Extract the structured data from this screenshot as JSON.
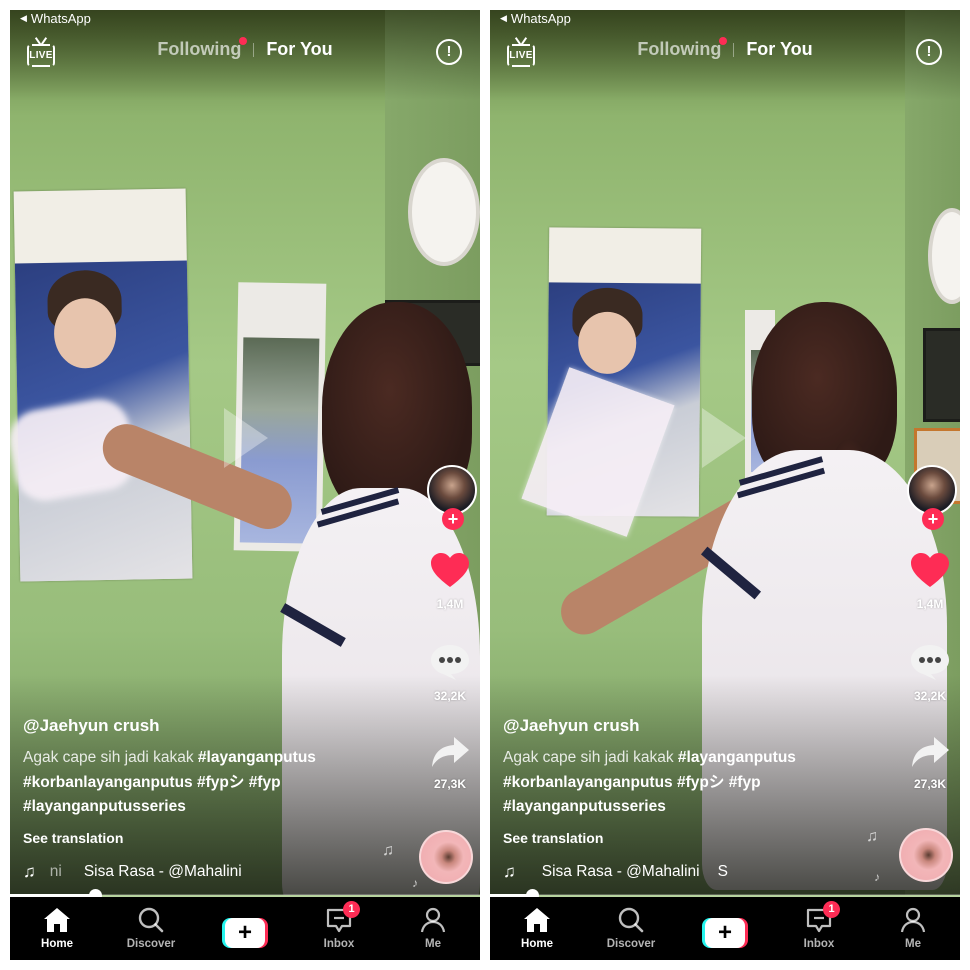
{
  "panels": [
    {
      "status_bar": {
        "back_app": "WhatsApp"
      },
      "top_nav": {
        "live_label": "LIVE",
        "tabs": [
          {
            "label": "Following",
            "active": false,
            "has_notification_dot": true
          },
          {
            "label": "For You",
            "active": true
          }
        ],
        "report_icon": "!"
      },
      "creator": {
        "avatar_alt": "creator-avatar",
        "follow_label": "+"
      },
      "actions": {
        "likes": "1,4M",
        "comments": "32,2K",
        "shares": "27,3K"
      },
      "caption": {
        "username": "@Jaehyun crush",
        "description_plain": "Agak cape sih jadi kakak ",
        "hashtags": [
          "#layanganputus",
          "#korbanlayanganputus",
          "#fypシ",
          "#fyp",
          "#layanganputusseries"
        ],
        "see_translation": "See translation"
      },
      "music": {
        "prefix_fragment": "ni",
        "track": "Sisa Rasa - @Mahalini",
        "trailing_fragment": ""
      },
      "progress_percent": 18,
      "bottom_nav": {
        "items": [
          {
            "label": "Home",
            "icon": "home-icon",
            "active": true
          },
          {
            "label": "Discover",
            "icon": "search-icon",
            "active": false
          },
          {
            "label": "+",
            "icon": "create-icon",
            "active": false
          },
          {
            "label": "Inbox",
            "icon": "inbox-icon",
            "active": false,
            "badge": "1"
          },
          {
            "label": "Me",
            "icon": "profile-icon",
            "active": false
          }
        ]
      }
    },
    {
      "status_bar": {
        "back_app": "WhatsApp"
      },
      "top_nav": {
        "live_label": "LIVE",
        "tabs": [
          {
            "label": "Following",
            "active": false,
            "has_notification_dot": true
          },
          {
            "label": "For You",
            "active": true
          }
        ],
        "report_icon": "!"
      },
      "creator": {
        "avatar_alt": "creator-avatar",
        "follow_label": "+"
      },
      "actions": {
        "likes": "1,4M",
        "comments": "32,2K",
        "shares": "27,3K"
      },
      "caption": {
        "username": "@Jaehyun crush",
        "description_plain": "Agak cape sih jadi kakak ",
        "hashtags": [
          "#layanganputus",
          "#korbanlayanganputus",
          "#fypシ",
          "#fyp",
          "#layanganputusseries"
        ],
        "see_translation": "See translation"
      },
      "music": {
        "prefix_fragment": "",
        "track": "Sisa Rasa - @Mahalini",
        "trailing_fragment": "S"
      },
      "progress_percent": 9,
      "bottom_nav": {
        "items": [
          {
            "label": "Home",
            "icon": "home-icon",
            "active": true
          },
          {
            "label": "Discover",
            "icon": "search-icon",
            "active": false
          },
          {
            "label": "+",
            "icon": "create-icon",
            "active": false
          },
          {
            "label": "Inbox",
            "icon": "inbox-icon",
            "active": false,
            "badge": "1"
          },
          {
            "label": "Me",
            "icon": "profile-icon",
            "active": false
          }
        ]
      }
    }
  ],
  "colors": {
    "accent_red": "#fe2c55",
    "accent_cyan": "#25f4ee",
    "nav_background": "#000000",
    "wall_green": "#a5c986"
  }
}
